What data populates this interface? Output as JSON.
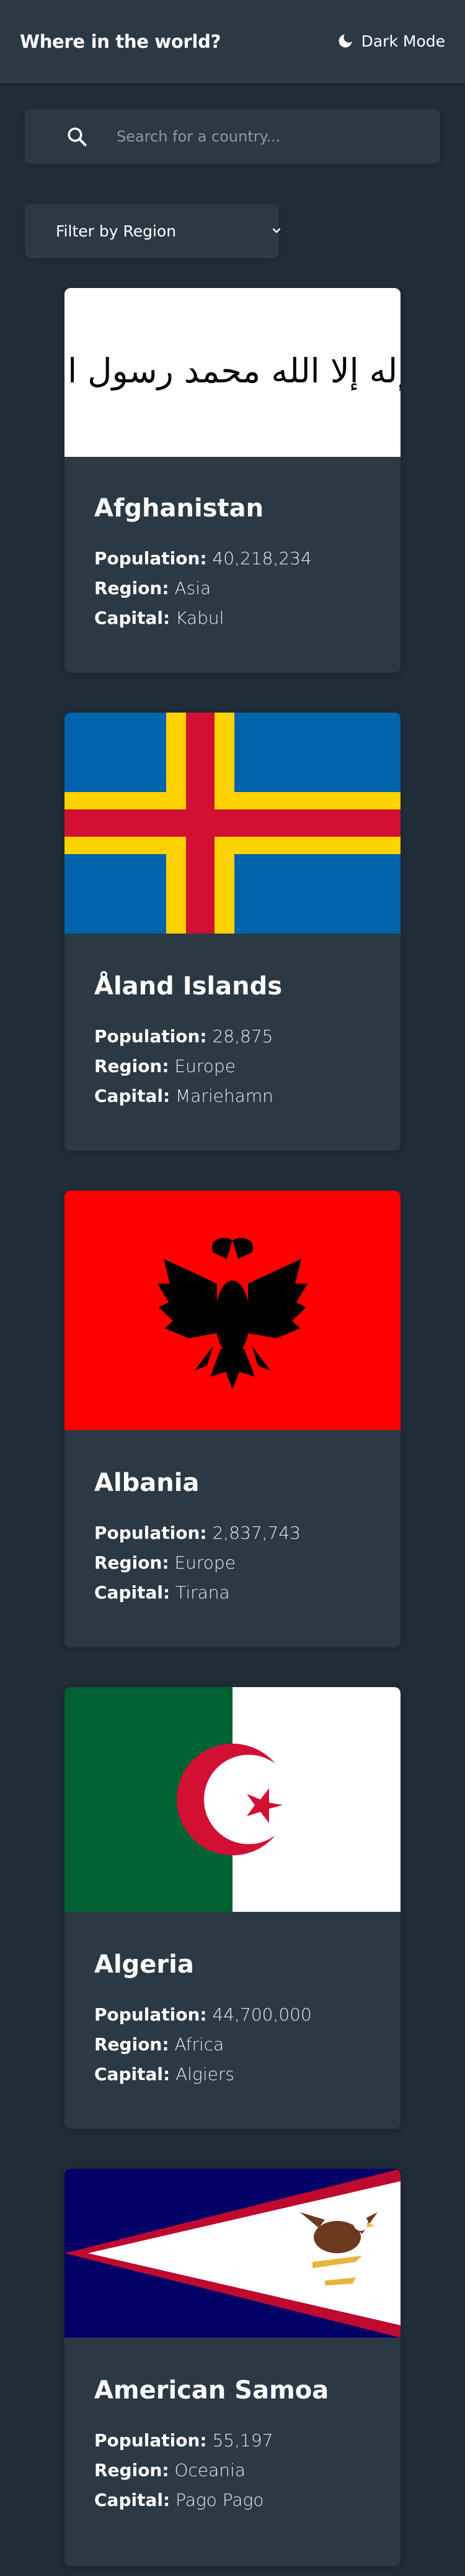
{
  "header": {
    "title": "Where in the world?",
    "mode_label": "Dark Mode",
    "mode_icon": "moon-icon"
  },
  "search": {
    "placeholder": "Search for a country...",
    "value": "",
    "icon": "search-icon"
  },
  "filter": {
    "label": "Filter by Region",
    "icon": "chevron-down-icon"
  },
  "labels": {
    "population": "Population:",
    "region": "Region:",
    "capital": "Capital:"
  },
  "countries": [
    {
      "name": "Afghanistan",
      "population": "40,218,234",
      "region": "Asia",
      "capital": "Kabul",
      "flag": "afghanistan-flag",
      "flag_text": "لا إله إلا الله محمد رسول الله"
    },
    {
      "name": "Åland Islands",
      "population": "28,875",
      "region": "Europe",
      "capital": "Mariehamn",
      "flag": "aland-islands-flag"
    },
    {
      "name": "Albania",
      "population": "2,837,743",
      "region": "Europe",
      "capital": "Tirana",
      "flag": "albania-flag"
    },
    {
      "name": "Algeria",
      "population": "44,700,000",
      "region": "Africa",
      "capital": "Algiers",
      "flag": "algeria-flag"
    },
    {
      "name": "American Samoa",
      "population": "55,197",
      "region": "Oceania",
      "capital": "Pago Pago",
      "flag": "american-samoa-flag"
    }
  ],
  "colors": {
    "background": "#202c37",
    "element": "#2b3945",
    "text": "#ffffff"
  }
}
